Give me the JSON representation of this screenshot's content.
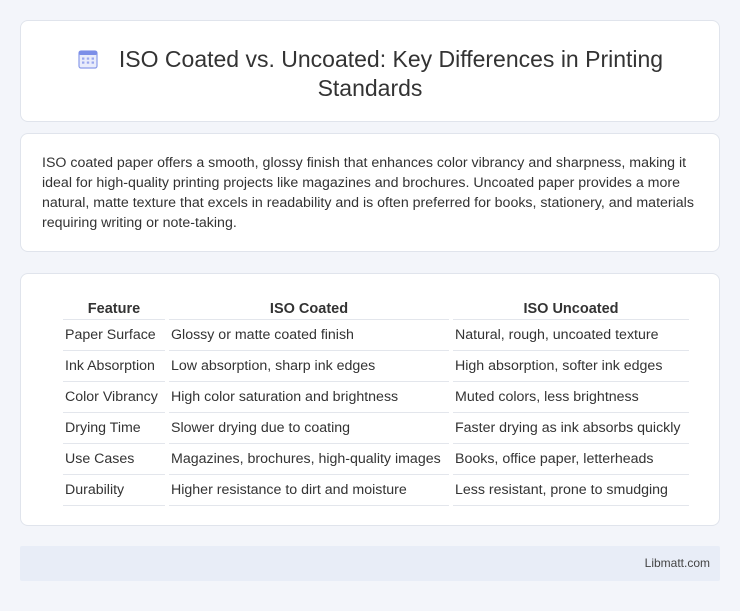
{
  "header": {
    "title": "ISO Coated vs. Uncoated: Key Differences in Printing Standards",
    "icon": "calendar-icon"
  },
  "intro": {
    "text": "ISO coated paper offers a smooth, glossy finish that enhances color vibrancy and sharpness, making it ideal for high-quality printing projects like magazines and brochures. Uncoated paper provides a more natural, matte texture that excels in readability and is often preferred for books, stationery, and materials requiring writing or note-taking."
  },
  "table": {
    "headers": [
      "Feature",
      "ISO Coated",
      "ISO Uncoated"
    ],
    "rows": [
      [
        "Paper Surface",
        "Glossy or matte coated finish",
        "Natural, rough, uncoated texture"
      ],
      [
        "Ink Absorption",
        "Low absorption, sharp ink edges",
        "High absorption, softer ink edges"
      ],
      [
        "Color Vibrancy",
        "High color saturation and brightness",
        "Muted colors, less brightness"
      ],
      [
        "Drying Time",
        "Slower drying due to coating",
        "Faster drying as ink absorbs quickly"
      ],
      [
        "Use Cases",
        "Magazines, brochures, high-quality images",
        "Books, office paper, letterheads"
      ],
      [
        "Durability",
        "Higher resistance to dirt and moisture",
        "Less resistant, prone to smudging"
      ]
    ]
  },
  "footer": {
    "text": "Libmatt.com"
  },
  "colors": {
    "background": "#f3f5fa",
    "card": "#ffffff",
    "footer": "#e8edf7",
    "icon_accent": "#7b8ee8"
  }
}
